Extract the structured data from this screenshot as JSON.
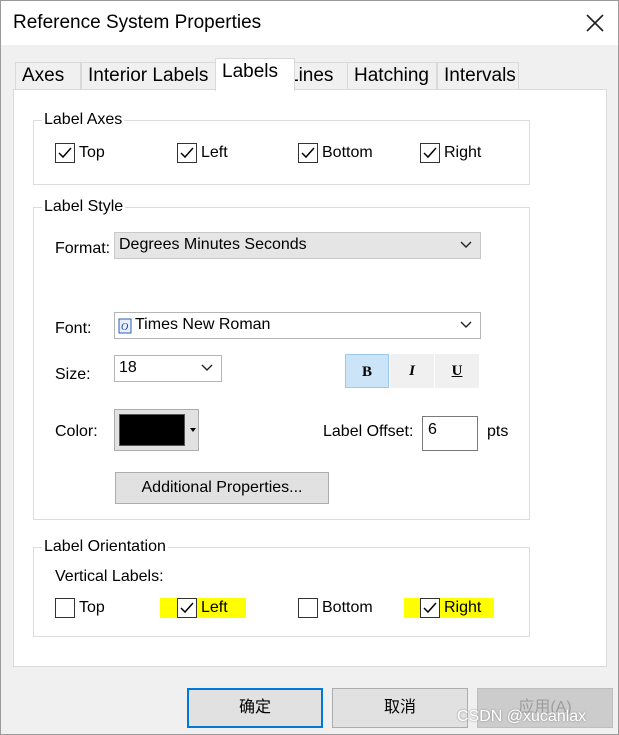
{
  "window": {
    "title": "Reference System Properties",
    "close_icon": "close-icon"
  },
  "tabs": [
    {
      "label": "Axes",
      "active": false
    },
    {
      "label": "Interior Labels",
      "active": false
    },
    {
      "label": "Labels",
      "active": true
    },
    {
      "label": "Lines",
      "active": false
    },
    {
      "label": "Hatching",
      "active": false
    },
    {
      "label": "Intervals",
      "active": false
    }
  ],
  "label_axes": {
    "title": "Label Axes",
    "items": [
      {
        "label": "Top",
        "checked": true
      },
      {
        "label": "Left",
        "checked": true
      },
      {
        "label": "Bottom",
        "checked": true
      },
      {
        "label": "Right",
        "checked": true
      }
    ]
  },
  "label_style": {
    "title": "Label Style",
    "format_label": "Format:",
    "format_value": "Degrees Minutes Seconds",
    "font_label": "Font:",
    "font_value": "Times New Roman",
    "size_label": "Size:",
    "size_value": "18",
    "bold": "B",
    "italic": "I",
    "underline": "U",
    "color_label": "Color:",
    "color_value": "#000000",
    "offset_label": "Label Offset:",
    "offset_value": "6",
    "offset_unit": "pts",
    "additional_button": "Additional Properties..."
  },
  "label_orientation": {
    "title": "Label Orientation",
    "vertical_label": "Vertical Labels:",
    "items": [
      {
        "label": "Top",
        "checked": false
      },
      {
        "label": "Left",
        "checked": true
      },
      {
        "label": "Bottom",
        "checked": false
      },
      {
        "label": "Right",
        "checked": true
      }
    ],
    "highlight_color": "#ffff00"
  },
  "buttons": {
    "ok": "确定",
    "cancel": "取消",
    "apply": "应用(A)"
  },
  "watermark": "CSDN @xucanlax"
}
